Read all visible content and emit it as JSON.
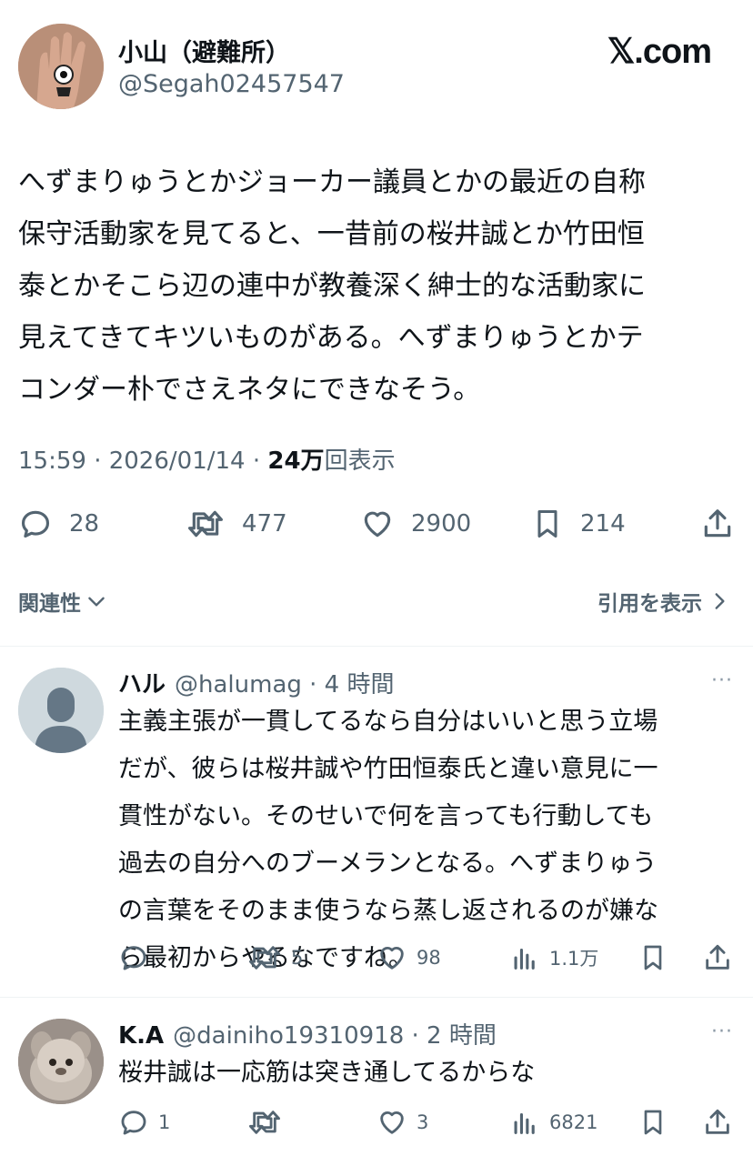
{
  "tweet": {
    "author_name": "小山（避難所）",
    "author_handle": "@Segah02457547",
    "site": "𝕏.com",
    "text": "へずまりゅうとかジョーカー議員とかの最近の自称\n保守活動家を見てると、一昔前の桜井誠とか竹田恒\n泰とかそこら辺の連中が教養深く紳士的な活動家に\n見えてきてキツいものがある。へずまりゅうとかテ\nコンダー朴でさえネタにできなそう。",
    "time": "15:59 · 2026/01/14 · ",
    "views_count": "24万",
    "views_label": "回表示",
    "replies": "28",
    "retweets": "477",
    "likes": "2900",
    "bookmarks": "214"
  },
  "links": {
    "related": "関連性",
    "quote": "引用を表示"
  },
  "replies": [
    {
      "name": "ハル",
      "handle_time": "@halumag · 4 時間",
      "text": "主義主張が一貫してるなら自分はいいと思う立場\nだが、彼らは桜井誠や竹田恒泰氏と違い意見に一\n貫性がない。そのせいで何を言っても行動しても\n過去の自分へのブーメランとなる。へずまりゅう\nの言葉をそのまま使うなら蒸し返されるのが嫌な\nら最初からやるなですね。",
      "replies": "",
      "retweets": "5",
      "likes": "98",
      "views": "1.1万",
      "more": "···"
    },
    {
      "name": "K.A",
      "handle_time": "@dainiho19310918 · 2 時間",
      "text": "桜井誠は一応筋は突き通してるからな",
      "replies": "1",
      "retweets": "",
      "likes": "3",
      "views": "6821",
      "more": "···"
    }
  ],
  "icons": {
    "colors": {
      "text": "#0f1419",
      "muted": "#536471",
      "divider": "#eff3f4",
      "more": "#8b98a5"
    }
  }
}
